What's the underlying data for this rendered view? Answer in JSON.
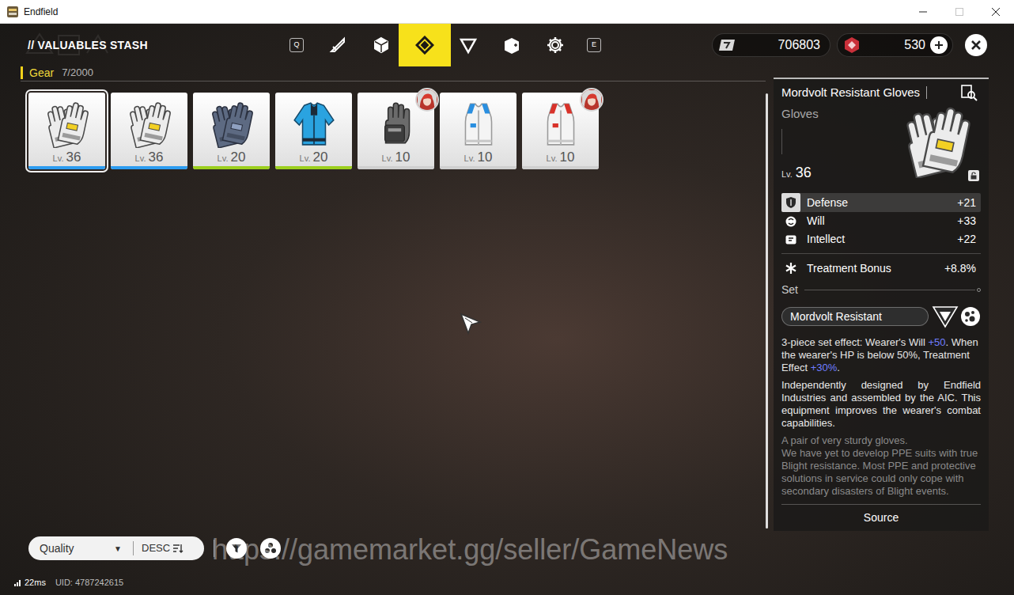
{
  "window": {
    "title": "Endfield"
  },
  "header": {
    "title": "// VALUABLES STASH",
    "prev_key": "Q",
    "next_key": "E",
    "tabs": [
      {
        "kind": "weapon",
        "selected": false
      },
      {
        "kind": "cube",
        "selected": false
      },
      {
        "kind": "gear",
        "selected": true
      },
      {
        "kind": "shard",
        "selected": false
      },
      {
        "kind": "crate",
        "selected": false
      },
      {
        "kind": "cog",
        "selected": false
      }
    ],
    "currencies": [
      {
        "kind": "credits",
        "amount": "706803",
        "addable": false
      },
      {
        "kind": "origeometry",
        "amount": "530",
        "addable": true
      }
    ]
  },
  "category": {
    "label": "Gear",
    "count": "7/2000"
  },
  "items": [
    {
      "kind": "gloves",
      "level_prefix": "Lv.",
      "level": "36",
      "color": "#2d9cf0",
      "selected": true,
      "equipped": false
    },
    {
      "kind": "gloves",
      "level_prefix": "Lv.",
      "level": "36",
      "color": "#2d9cf0",
      "selected": false,
      "equipped": false
    },
    {
      "kind": "mitts",
      "level_prefix": "Lv.",
      "level": "20",
      "color": "#9ccf1e",
      "selected": false,
      "equipped": false
    },
    {
      "kind": "jacket",
      "level_prefix": "Lv.",
      "level": "20",
      "color": "#9ccf1e",
      "selected": false,
      "equipped": false
    },
    {
      "kind": "gauntlet",
      "level_prefix": "Lv.",
      "level": "10",
      "color": "#cfcfcf",
      "selected": false,
      "equipped": true
    },
    {
      "kind": "vest",
      "level_prefix": "Lv.",
      "level": "10",
      "color": "#cfcfcf",
      "selected": false,
      "equipped": false
    },
    {
      "kind": "harness",
      "level_prefix": "Lv.",
      "level": "10",
      "color": "#cfcfcf",
      "selected": false,
      "equipped": true
    }
  ],
  "detail": {
    "name": "Mordvolt Resistant Gloves",
    "type": "Gloves",
    "level_prefix": "Lv.",
    "level": "36",
    "locked": false,
    "stats": [
      {
        "kind": "defense",
        "label": "Defense",
        "value": "+21",
        "highlighted": true
      },
      {
        "kind": "will",
        "label": "Will",
        "value": "+33",
        "highlighted": false
      },
      {
        "kind": "intellect",
        "label": "Intellect",
        "value": "+22",
        "highlighted": false
      }
    ],
    "bonus": {
      "label": "Treatment Bonus",
      "value": "+8.8%"
    },
    "set_label": "Set",
    "set_name": "Mordvolt Resistant",
    "set_effect": [
      {
        "text": "3-piece set effect: Wearer's Will ",
        "highlight": false
      },
      {
        "text": "+50",
        "highlight": true
      },
      {
        "text": ". When the wearer's HP is below 50%, Treatment Effect ",
        "highlight": false
      },
      {
        "text": "+30%",
        "highlight": true
      },
      {
        "text": ".",
        "highlight": false
      }
    ],
    "description": "Independently designed by Endfield Industries and assembled by the AIC. This equipment improves the wearer's combat capabilities.",
    "flavor": [
      "A pair of very sturdy gloves.",
      "We have yet to develop PPE suits with true Blight resistance. Most PPE and protective solutions in service could only cope with secondary disasters of Blight events."
    ],
    "source": "Source"
  },
  "toolbar": {
    "sort": "Quality",
    "sort_arrow": "▼",
    "order": "DESC"
  },
  "watermark": "https://gamemarket.gg/seller/GameNews",
  "status": {
    "ping": "22ms",
    "uid": "UID: 4787242615"
  }
}
